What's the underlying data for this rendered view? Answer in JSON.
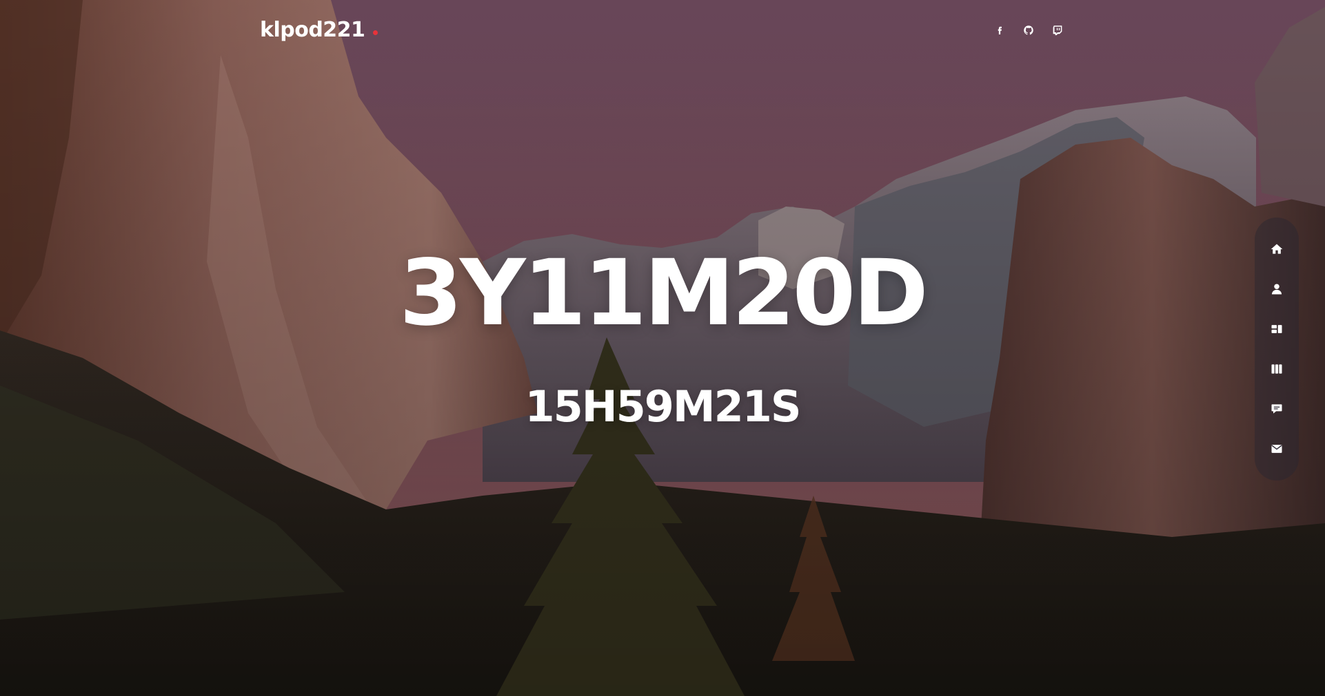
{
  "header": {
    "logo_text": "klpod221",
    "logo_dot_color": "#e8333a",
    "social_links": [
      {
        "icon": "facebook-icon"
      },
      {
        "icon": "github-icon"
      },
      {
        "icon": "twitch-icon"
      }
    ]
  },
  "hero": {
    "headline": "3Y11M20D",
    "subline": "15H59M21S",
    "text_color": "#ffffff"
  },
  "sidenav": {
    "items": [
      {
        "icon": "home-icon"
      },
      {
        "icon": "user-icon"
      },
      {
        "icon": "dashboard-icon"
      },
      {
        "icon": "columns-icon"
      },
      {
        "icon": "message-icon"
      },
      {
        "icon": "mail-icon"
      }
    ]
  }
}
